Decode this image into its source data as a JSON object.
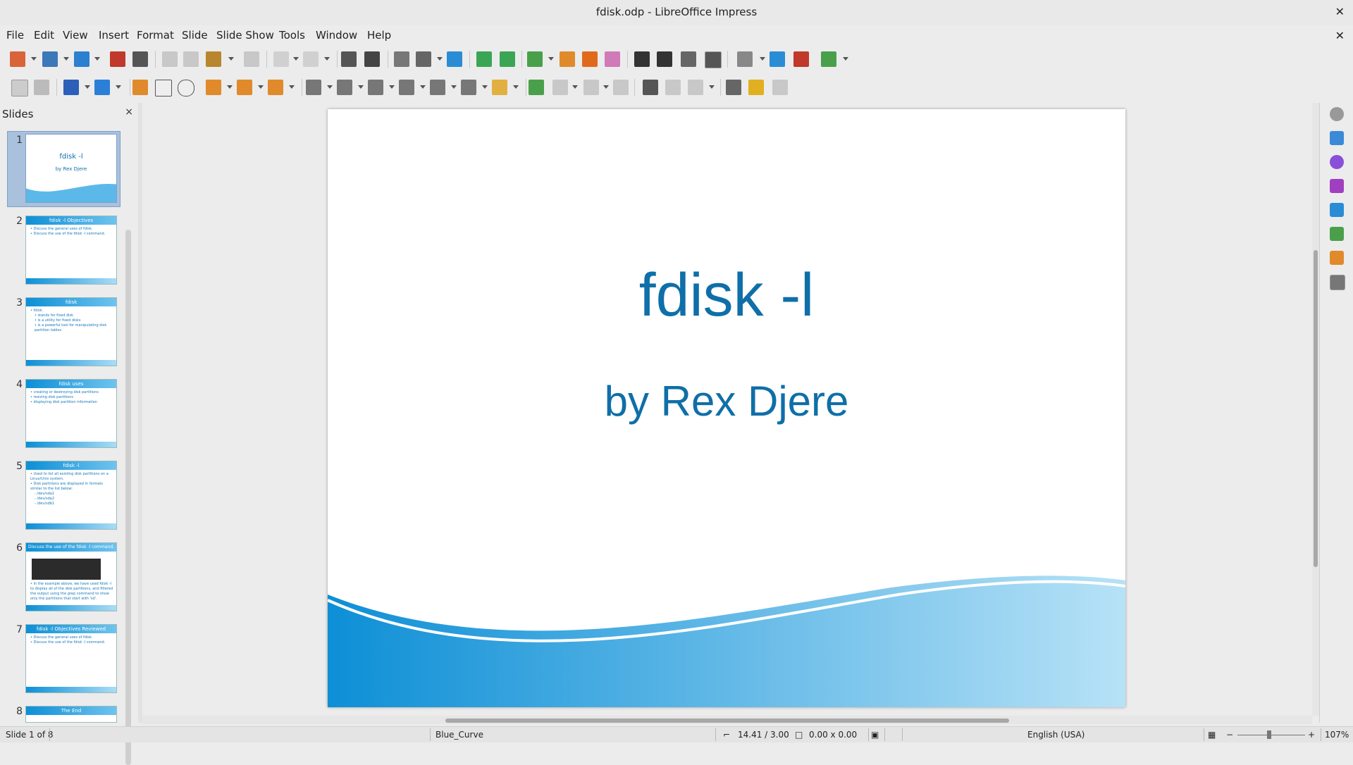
{
  "window": {
    "title": "fdisk.odp - LibreOffice Impress"
  },
  "menu": [
    "File",
    "Edit",
    "View",
    "Insert",
    "Format",
    "Slide",
    "Slide Show",
    "Tools",
    "Window",
    "Help"
  ],
  "panel": {
    "title": "Slides",
    "close_glyph": "×"
  },
  "slides": [
    {
      "num": "1",
      "title": "fdisk -l",
      "subtitle": "by Rex Djere",
      "type": "title"
    },
    {
      "num": "2",
      "title": "fdisk -l Objectives",
      "type": "bullets",
      "bullets": [
        "Discuss the general uses of fdisk.",
        "Discuss the use of the fdisk -l command."
      ]
    },
    {
      "num": "3",
      "title": "fdisk",
      "type": "bullets",
      "bullets": [
        "fdisk:",
        "stands for fixed disk",
        "is a utility for fixed disks",
        "is a powerful tool for manipulating disk partition tables"
      ]
    },
    {
      "num": "4",
      "title": "fdisk uses",
      "type": "bullets",
      "bullets": [
        "creating or destroying disk partitions",
        "resizing disk partitions",
        "displaying disk partition information"
      ]
    },
    {
      "num": "5",
      "title": "fdisk -l",
      "type": "bullets",
      "bullets": [
        "Used to list all existing disk partitions on a Linux/Unix system.",
        "Disk partitions are displayed in formats similar to the list below:",
        "/dev/sda1",
        "/dev/sda2",
        "/dev/sdb1"
      ]
    },
    {
      "num": "6",
      "title": "Discuss the use of the fdisk -l command.",
      "type": "terminal",
      "bullets": [
        "In the example above, we have used fdisk -l to display all of the disk partitions, and filtered the output using the grep command to show only the partitions that start with 'sd'."
      ]
    },
    {
      "num": "7",
      "title": "fdisk -l Objectives Reviewed",
      "type": "bullets",
      "bullets": [
        "Discuss the general uses of fdisk.",
        "Discuss the use of the fdisk -l command."
      ]
    },
    {
      "num": "8",
      "title": "The End",
      "type": "bullets",
      "bullets": []
    }
  ],
  "main_slide": {
    "title": "fdisk -l",
    "subtitle": "by Rex Djere"
  },
  "status": {
    "slide_info": "Slide 1 of 8",
    "master": "Blue_Curve",
    "position": "14.41 / 3.00",
    "size": "0.00 x 0.00",
    "language": "English (USA)",
    "zoom": "107%"
  },
  "colors": {
    "accent": "#0f6fa8",
    "wave_dark": "#0d8fd6",
    "wave_light": "#b7e2f7"
  }
}
